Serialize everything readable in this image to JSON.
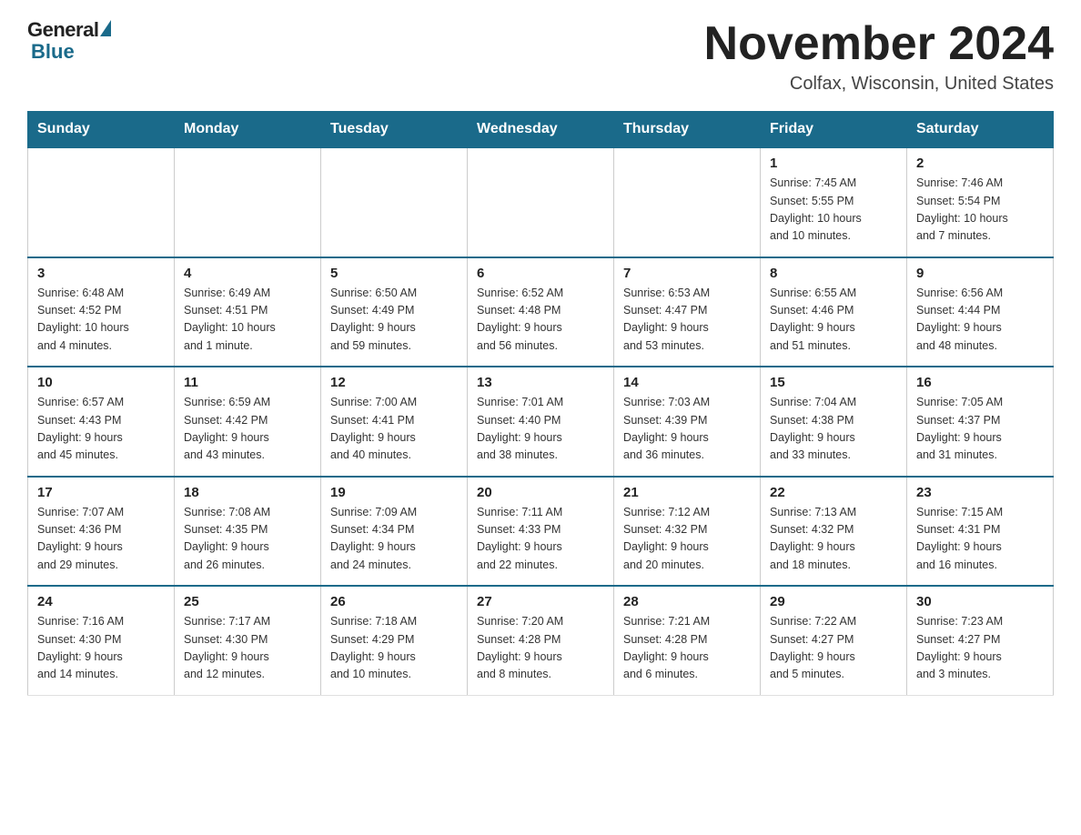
{
  "logo": {
    "general": "General",
    "blue": "Blue"
  },
  "title": "November 2024",
  "location": "Colfax, Wisconsin, United States",
  "weekdays": [
    "Sunday",
    "Monday",
    "Tuesday",
    "Wednesday",
    "Thursday",
    "Friday",
    "Saturday"
  ],
  "weeks": [
    [
      {
        "day": "",
        "info": ""
      },
      {
        "day": "",
        "info": ""
      },
      {
        "day": "",
        "info": ""
      },
      {
        "day": "",
        "info": ""
      },
      {
        "day": "",
        "info": ""
      },
      {
        "day": "1",
        "info": "Sunrise: 7:45 AM\nSunset: 5:55 PM\nDaylight: 10 hours\nand 10 minutes."
      },
      {
        "day": "2",
        "info": "Sunrise: 7:46 AM\nSunset: 5:54 PM\nDaylight: 10 hours\nand 7 minutes."
      }
    ],
    [
      {
        "day": "3",
        "info": "Sunrise: 6:48 AM\nSunset: 4:52 PM\nDaylight: 10 hours\nand 4 minutes."
      },
      {
        "day": "4",
        "info": "Sunrise: 6:49 AM\nSunset: 4:51 PM\nDaylight: 10 hours\nand 1 minute."
      },
      {
        "day": "5",
        "info": "Sunrise: 6:50 AM\nSunset: 4:49 PM\nDaylight: 9 hours\nand 59 minutes."
      },
      {
        "day": "6",
        "info": "Sunrise: 6:52 AM\nSunset: 4:48 PM\nDaylight: 9 hours\nand 56 minutes."
      },
      {
        "day": "7",
        "info": "Sunrise: 6:53 AM\nSunset: 4:47 PM\nDaylight: 9 hours\nand 53 minutes."
      },
      {
        "day": "8",
        "info": "Sunrise: 6:55 AM\nSunset: 4:46 PM\nDaylight: 9 hours\nand 51 minutes."
      },
      {
        "day": "9",
        "info": "Sunrise: 6:56 AM\nSunset: 4:44 PM\nDaylight: 9 hours\nand 48 minutes."
      }
    ],
    [
      {
        "day": "10",
        "info": "Sunrise: 6:57 AM\nSunset: 4:43 PM\nDaylight: 9 hours\nand 45 minutes."
      },
      {
        "day": "11",
        "info": "Sunrise: 6:59 AM\nSunset: 4:42 PM\nDaylight: 9 hours\nand 43 minutes."
      },
      {
        "day": "12",
        "info": "Sunrise: 7:00 AM\nSunset: 4:41 PM\nDaylight: 9 hours\nand 40 minutes."
      },
      {
        "day": "13",
        "info": "Sunrise: 7:01 AM\nSunset: 4:40 PM\nDaylight: 9 hours\nand 38 minutes."
      },
      {
        "day": "14",
        "info": "Sunrise: 7:03 AM\nSunset: 4:39 PM\nDaylight: 9 hours\nand 36 minutes."
      },
      {
        "day": "15",
        "info": "Sunrise: 7:04 AM\nSunset: 4:38 PM\nDaylight: 9 hours\nand 33 minutes."
      },
      {
        "day": "16",
        "info": "Sunrise: 7:05 AM\nSunset: 4:37 PM\nDaylight: 9 hours\nand 31 minutes."
      }
    ],
    [
      {
        "day": "17",
        "info": "Sunrise: 7:07 AM\nSunset: 4:36 PM\nDaylight: 9 hours\nand 29 minutes."
      },
      {
        "day": "18",
        "info": "Sunrise: 7:08 AM\nSunset: 4:35 PM\nDaylight: 9 hours\nand 26 minutes."
      },
      {
        "day": "19",
        "info": "Sunrise: 7:09 AM\nSunset: 4:34 PM\nDaylight: 9 hours\nand 24 minutes."
      },
      {
        "day": "20",
        "info": "Sunrise: 7:11 AM\nSunset: 4:33 PM\nDaylight: 9 hours\nand 22 minutes."
      },
      {
        "day": "21",
        "info": "Sunrise: 7:12 AM\nSunset: 4:32 PM\nDaylight: 9 hours\nand 20 minutes."
      },
      {
        "day": "22",
        "info": "Sunrise: 7:13 AM\nSunset: 4:32 PM\nDaylight: 9 hours\nand 18 minutes."
      },
      {
        "day": "23",
        "info": "Sunrise: 7:15 AM\nSunset: 4:31 PM\nDaylight: 9 hours\nand 16 minutes."
      }
    ],
    [
      {
        "day": "24",
        "info": "Sunrise: 7:16 AM\nSunset: 4:30 PM\nDaylight: 9 hours\nand 14 minutes."
      },
      {
        "day": "25",
        "info": "Sunrise: 7:17 AM\nSunset: 4:30 PM\nDaylight: 9 hours\nand 12 minutes."
      },
      {
        "day": "26",
        "info": "Sunrise: 7:18 AM\nSunset: 4:29 PM\nDaylight: 9 hours\nand 10 minutes."
      },
      {
        "day": "27",
        "info": "Sunrise: 7:20 AM\nSunset: 4:28 PM\nDaylight: 9 hours\nand 8 minutes."
      },
      {
        "day": "28",
        "info": "Sunrise: 7:21 AM\nSunset: 4:28 PM\nDaylight: 9 hours\nand 6 minutes."
      },
      {
        "day": "29",
        "info": "Sunrise: 7:22 AM\nSunset: 4:27 PM\nDaylight: 9 hours\nand 5 minutes."
      },
      {
        "day": "30",
        "info": "Sunrise: 7:23 AM\nSunset: 4:27 PM\nDaylight: 9 hours\nand 3 minutes."
      }
    ]
  ]
}
